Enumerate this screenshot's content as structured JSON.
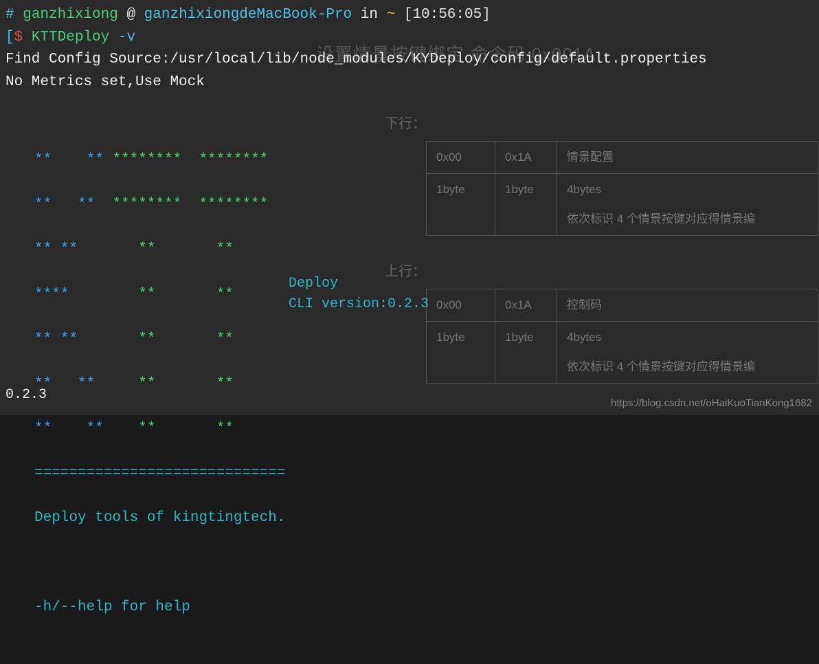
{
  "prompt": {
    "hash": "#",
    "user": "ganzhixiong",
    "at": "@",
    "host": "ganzhixiongdeMacBook-Pro",
    "in": "in",
    "path": "~",
    "time": "[10:56:05]",
    "lbracket": "[",
    "dollar": "$",
    "command": "KTTDeploy",
    "arg": "-v"
  },
  "output": {
    "line1": "Find Config Source:/usr/local/lib/node_modules/KYDeploy/config/default.properties",
    "line2": "No Metrics set,Use Mock"
  },
  "ascii": {
    "rows": [
      {
        "blue": "**    ** ",
        "green": "********  ********"
      },
      {
        "blue": "**   **  ",
        "green": "********  ********"
      },
      {
        "blue": "** **    ",
        "green": "   **       **"
      },
      {
        "blue": "****     ",
        "green": "   **       **"
      },
      {
        "blue": "** **    ",
        "green": "   **       **"
      },
      {
        "blue": "**   **  ",
        "green": "   **       **"
      },
      {
        "blue": "**    ** ",
        "green": "   **       **"
      }
    ],
    "divider": "=============================",
    "tagline": "Deploy tools of kingtingtech.",
    "help": "-h/--help for help"
  },
  "side": {
    "line1": "Deploy",
    "line2": "CLI version:0.2.3"
  },
  "version": "0.2.3",
  "bg_doc": {
    "heading": "设置情景按键绑定    命令码 0x001A",
    "section1_label": "下行：",
    "section2_label": "上行：",
    "table1": {
      "r1c1": "0x00",
      "r1c2": "0x1A",
      "r1c3": "情景配置",
      "r2c1": "1byte",
      "r2c2": "1byte",
      "r2c3a": "4bytes",
      "r2c3b": "依次标识 4 个情景按键对应得情景编"
    },
    "table2": {
      "r1c1": "0x00",
      "r1c2": "0x1A",
      "r1c3": "控制码",
      "r2c1": "1byte",
      "r2c2": "1byte",
      "r2c3a": "4bytes",
      "r2c3b": "依次标识 4 个情景按键对应得情景编"
    }
  },
  "watermark": "https://blog.csdn.net/oHaiKuoTianKong1682"
}
